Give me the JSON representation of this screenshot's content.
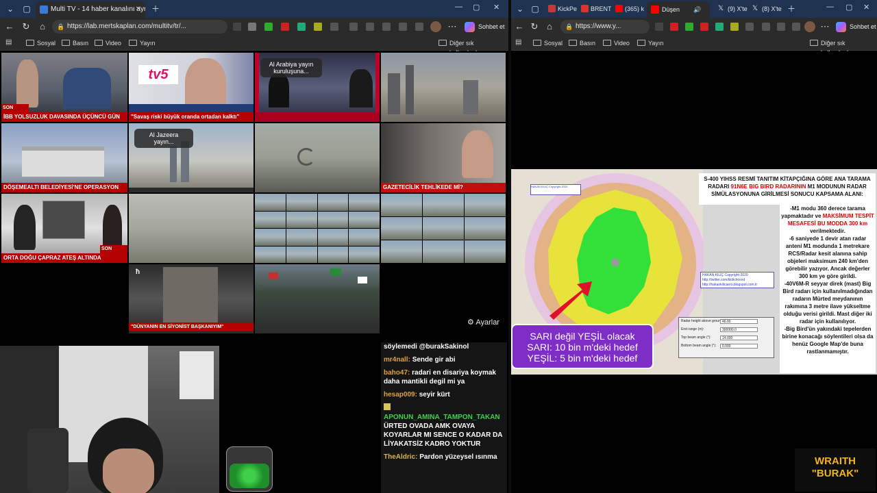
{
  "left_window": {
    "active_tab_title": "Multi TV - 14 haber kanalını aynı a",
    "url": "https://lab.mertskaplan.com/multitv/tr/...",
    "favorites": [
      "Sosyal",
      "Basın",
      "Video",
      "Yayın"
    ],
    "other_favorites": "Diğer sık kullanılanlar",
    "copilot_label": "Sohbet et"
  },
  "right_window": {
    "tabs": [
      "KickPe",
      "BRENT",
      "(365) k",
      "Düşen",
      "(9) X'te",
      "(8) X'te"
    ],
    "url": "https://www.y...",
    "favorites": [
      "Sosyal",
      "Basın",
      "Video",
      "Yayın"
    ],
    "other_favorites": "Diğer sık kullanılanlar",
    "copilot_label": "Sohbet et"
  },
  "tiles": {
    "t1_ticker": "İBB YOLSUZLUK DAVASINDA ÜÇÜNCÜ GÜN",
    "t1_badge": "SON DAKİKA",
    "t2_logo": "tv5",
    "t2_ticker": "\"Savaş riski büyük oranda ortadan kalktı\"",
    "t3_pill": "Al Arabiya yayın kuruluşuna...",
    "t5_ticker": "DÖŞEMEALTI BELEDİYESİ'NE OPERASYON",
    "t6_pill": "Al Jazeera yayın...",
    "t8_ticker": "GAZETECİLİK TEHLİKEDE Mİ?",
    "t9_ticker": "ORTA DOĞU ÇAPRAZ ATEŞ ALTINDA",
    "t9_badge": "SON DAKİKA",
    "t13_ticker": "\"DÜNYANIN EN SİYONİST BAŞKANIYIM\""
  },
  "settings_label": "Ayarlar",
  "chat": [
    {
      "user": "",
      "text": "söylemedi @burakSakinol",
      "color": "#ffffff"
    },
    {
      "user": "mr4nall:",
      "text": "Sende gir abi",
      "color": "#e0a040"
    },
    {
      "user": "baho47:",
      "text": "radari en disariya koymak daha mantikli degil mi ya",
      "color": "#e0a040"
    },
    {
      "user": "hesap009:",
      "text": "seyir kürt",
      "color": "#e0a040"
    },
    {
      "user": "APONUN_AMINA_TAMPON_TAKAN",
      "text": "ÜRTED OVADA AMK OVAYA KOYARLAR MI SENCE O KADAR DA LİYAKATSİZ KADRO YOKTUR",
      "color": "#3ad44c"
    },
    {
      "user": "TheAldric:",
      "text": "Pardon yüzeysel ısınma",
      "color": "#d6b84a"
    }
  ],
  "slide": {
    "header_a": "S-400 YIHSS RESMİ TANITIM KİTAPÇIĞINA GÖRE ANA TARAMA RADARI",
    "header_red": "91N6E BIG BIRD RADARININ",
    "header_b": "M1 MODUNUN RADAR SİMÜLASYONUNA GİRİLMESİ SONUCU KAPSAMA ALANI:",
    "body_1": "-M1 modu 360 derece tarama yapmaktadır ve",
    "body_red": "MAKSİMUM TESPİT MESAFESİ BU MODDA 300 km",
    "body_2": "verilmektedir.",
    "body_3": "-6 saniyede 1 devir atan radar anteni M1 modunda 1 metrekare RCS/Radar kesit alanına sahip objeleri maksimum 240 km'den görebilir yazıyor. Ancak değerler 300 km ye göre girildi.",
    "body_4": "-40V6M-R seyyar direk (mast) Big Bird radarı için kullanılmadığından radarın Mürted meydanının rakımına 3 metre ilave yükseltme olduğu verisi girildi. Mast diğer iki radar için kullanılıyor.",
    "body_5": "-Big Bird'ün yakındaki tepelerden birine konacağı söylentileri olsa da henüz Google Map'de buna rastlanmamıştır.",
    "caption_1": "SARI değil YEŞİL olacak",
    "caption_2": "SARI: 10 bin m'deki hedef",
    "caption_3": "YEŞİL: 5 bin m'deki hedef",
    "credit_1": "HAKAN KILIÇ  Copyright-2020",
    "credit_2": "http://twitter.com/kkilichosnd",
    "credit_3": "http://hakankilicaero.blogspot.com.tr",
    "panel_rows": [
      {
        "label": "Radar height above ground (m):",
        "value": "46.00"
      },
      {
        "label": "End range (m):",
        "value": "300000.0"
      },
      {
        "label": "Top beam angle (°):",
        "value": "14.000"
      },
      {
        "label": "Bottom beam angle (°):",
        "value": "0.000"
      }
    ]
  },
  "streamer_logo": {
    "line1": "WRAITH",
    "line2": "\"BURAK\""
  },
  "colors": {
    "tab_bar": "#1f3350",
    "browser_chrome": "#2b2b2b",
    "ticker_red": "#b40000",
    "caption_purple": "#7e2ec7",
    "radar_green": "#33e03a",
    "radar_yellow": "#e7e33a"
  }
}
